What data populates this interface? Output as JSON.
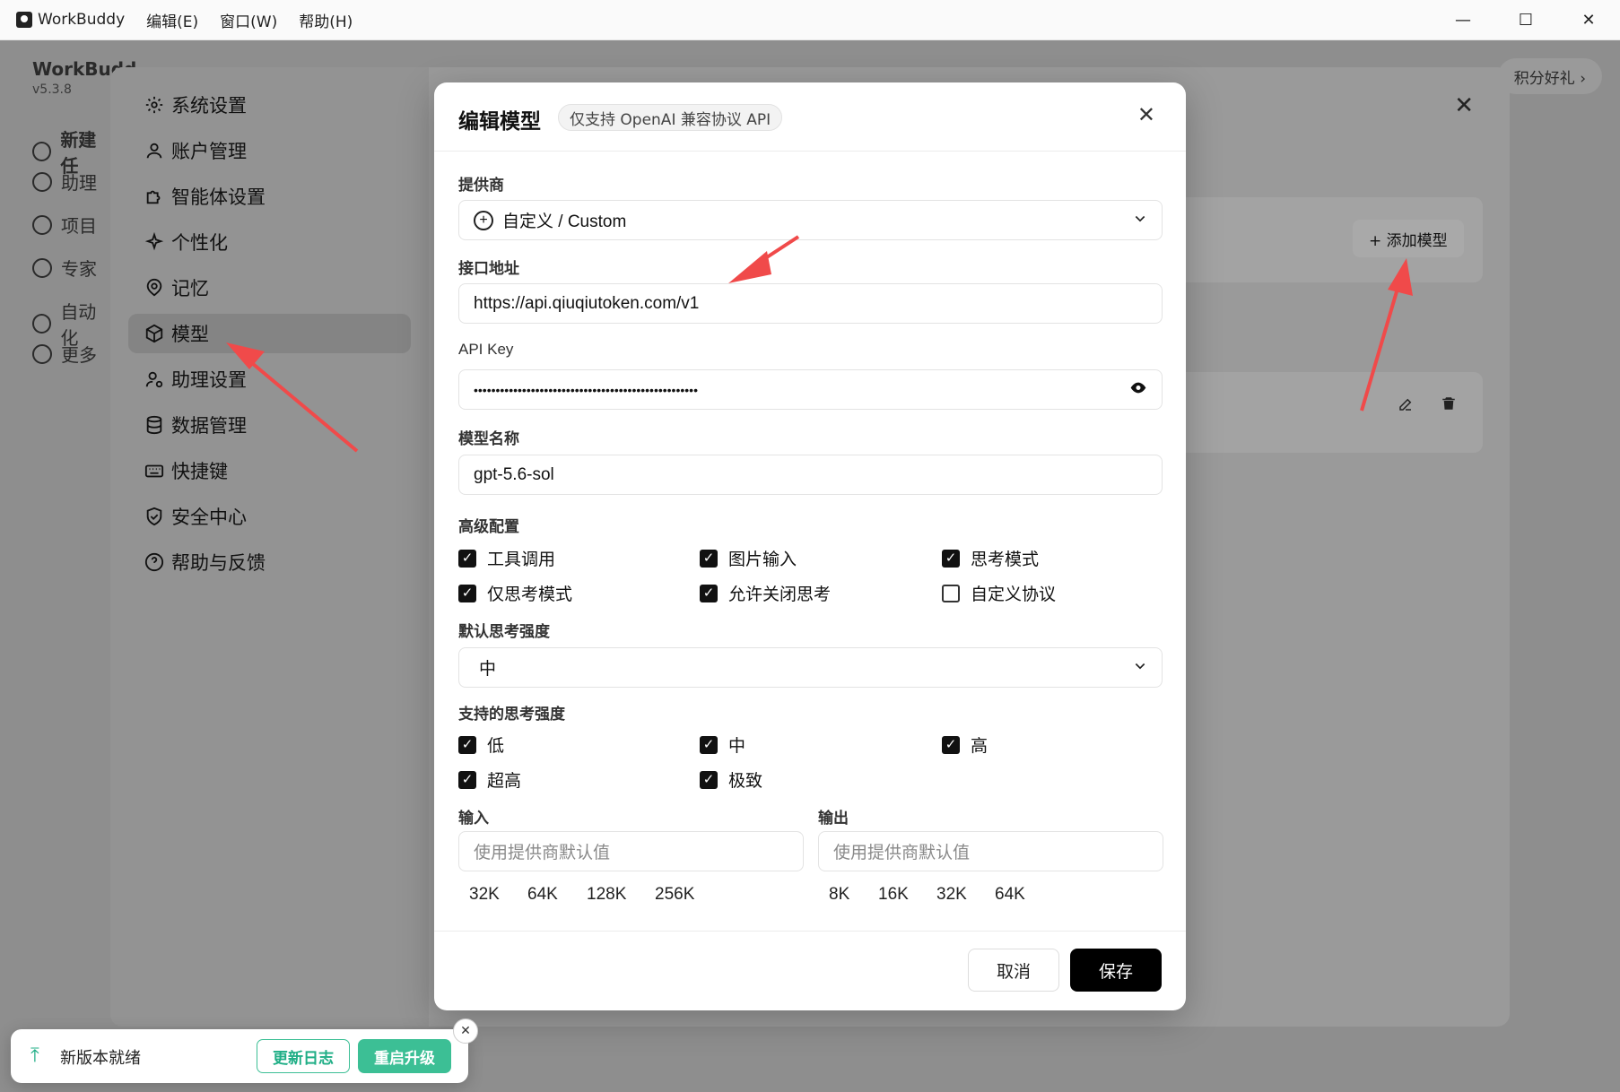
{
  "titlebar": {
    "app_name": "WorkBuddy",
    "menus": [
      "编辑(E)",
      "窗口(W)",
      "帮助(H)"
    ],
    "minimize": "—",
    "maximize": "☐",
    "close": "✕"
  },
  "background": {
    "brand": "WorkBudd",
    "version": "v5.3.8",
    "nav": [
      "新建任",
      "助理",
      "项目",
      "专家",
      "自动化",
      "更多"
    ],
    "promo": "积分好礼 ›"
  },
  "settings": {
    "close": "✕",
    "add_model": "+ 添加模型",
    "nav": [
      {
        "label": "系统设置",
        "icon": "gear-icon"
      },
      {
        "label": "账户管理",
        "icon": "user-icon"
      },
      {
        "label": "智能体设置",
        "icon": "puzzle-icon"
      },
      {
        "label": "个性化",
        "icon": "sparkle-icon"
      },
      {
        "label": "记忆",
        "icon": "brain-icon"
      },
      {
        "label": "模型",
        "icon": "cube-icon"
      },
      {
        "label": "助理设置",
        "icon": "user-gear-icon"
      },
      {
        "label": "数据管理",
        "icon": "database-icon"
      },
      {
        "label": "快捷键",
        "icon": "keyboard-icon"
      },
      {
        "label": "安全中心",
        "icon": "shield-icon"
      },
      {
        "label": "帮助与反馈",
        "icon": "help-icon"
      }
    ],
    "active_index": 5
  },
  "modal": {
    "title": "编辑模型",
    "badge": "仅支持 OpenAI 兼容协议 API",
    "close": "✕",
    "provider_label": "提供商",
    "provider_value": "自定义 / Custom",
    "endpoint_label": "接口地址",
    "endpoint_value": "https://api.qiuqiutoken.com/v1",
    "apikey_label": "API Key",
    "apikey_value": "•••••••••••••••••••••••••••••••••••••••••••••••••••",
    "model_name_label": "模型名称",
    "model_name_value": "gpt-5.6-sol",
    "advanced_label": "高级配置",
    "advanced_options": [
      {
        "label": "工具调用",
        "checked": true
      },
      {
        "label": "图片输入",
        "checked": true
      },
      {
        "label": "思考模式",
        "checked": true
      },
      {
        "label": "仅思考模式",
        "checked": true
      },
      {
        "label": "允许关闭思考",
        "checked": true
      },
      {
        "label": "自定义协议",
        "checked": false
      }
    ],
    "default_effort_label": "默认思考强度",
    "default_effort_value": "中",
    "supported_effort_label": "支持的思考强度",
    "supported_efforts": [
      {
        "label": "低",
        "checked": true
      },
      {
        "label": "中",
        "checked": true
      },
      {
        "label": "高",
        "checked": true
      },
      {
        "label": "超高",
        "checked": true
      },
      {
        "label": "极致",
        "checked": true
      }
    ],
    "input_label": "输入",
    "input_placeholder": "使用提供商默认值",
    "input_chips": [
      "32K",
      "64K",
      "128K",
      "256K"
    ],
    "output_label": "输出",
    "output_placeholder": "使用提供商默认值",
    "output_chips": [
      "8K",
      "16K",
      "32K",
      "64K"
    ],
    "cancel": "取消",
    "save": "保存"
  },
  "toast": {
    "text": "新版本就绪",
    "changelog": "更新日志",
    "restart": "重启升级",
    "close": "✕"
  },
  "colors": {
    "accent_green": "#3cbf95",
    "annotation_red": "#f04a4a",
    "save_button": "#000000"
  }
}
